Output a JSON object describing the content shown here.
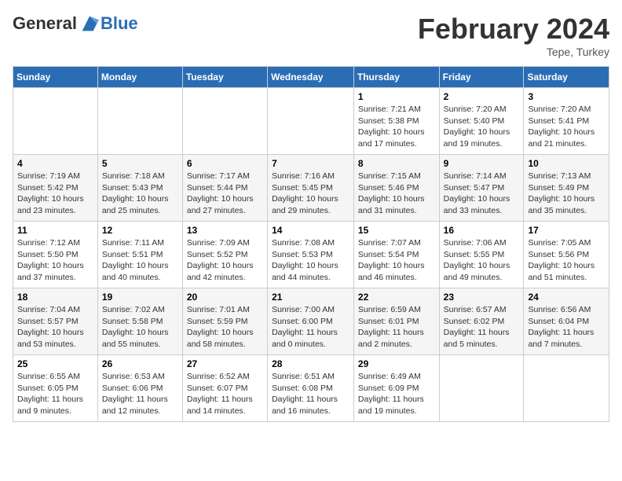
{
  "logo": {
    "general": "General",
    "blue": "Blue"
  },
  "header": {
    "title": "February 2024",
    "subtitle": "Tepe, Turkey"
  },
  "weekdays": [
    "Sunday",
    "Monday",
    "Tuesday",
    "Wednesday",
    "Thursday",
    "Friday",
    "Saturday"
  ],
  "weeks": [
    [
      {
        "day": "",
        "info": ""
      },
      {
        "day": "",
        "info": ""
      },
      {
        "day": "",
        "info": ""
      },
      {
        "day": "",
        "info": ""
      },
      {
        "day": "1",
        "info": "Sunrise: 7:21 AM\nSunset: 5:38 PM\nDaylight: 10 hours\nand 17 minutes."
      },
      {
        "day": "2",
        "info": "Sunrise: 7:20 AM\nSunset: 5:40 PM\nDaylight: 10 hours\nand 19 minutes."
      },
      {
        "day": "3",
        "info": "Sunrise: 7:20 AM\nSunset: 5:41 PM\nDaylight: 10 hours\nand 21 minutes."
      }
    ],
    [
      {
        "day": "4",
        "info": "Sunrise: 7:19 AM\nSunset: 5:42 PM\nDaylight: 10 hours\nand 23 minutes."
      },
      {
        "day": "5",
        "info": "Sunrise: 7:18 AM\nSunset: 5:43 PM\nDaylight: 10 hours\nand 25 minutes."
      },
      {
        "day": "6",
        "info": "Sunrise: 7:17 AM\nSunset: 5:44 PM\nDaylight: 10 hours\nand 27 minutes."
      },
      {
        "day": "7",
        "info": "Sunrise: 7:16 AM\nSunset: 5:45 PM\nDaylight: 10 hours\nand 29 minutes."
      },
      {
        "day": "8",
        "info": "Sunrise: 7:15 AM\nSunset: 5:46 PM\nDaylight: 10 hours\nand 31 minutes."
      },
      {
        "day": "9",
        "info": "Sunrise: 7:14 AM\nSunset: 5:47 PM\nDaylight: 10 hours\nand 33 minutes."
      },
      {
        "day": "10",
        "info": "Sunrise: 7:13 AM\nSunset: 5:49 PM\nDaylight: 10 hours\nand 35 minutes."
      }
    ],
    [
      {
        "day": "11",
        "info": "Sunrise: 7:12 AM\nSunset: 5:50 PM\nDaylight: 10 hours\nand 37 minutes."
      },
      {
        "day": "12",
        "info": "Sunrise: 7:11 AM\nSunset: 5:51 PM\nDaylight: 10 hours\nand 40 minutes."
      },
      {
        "day": "13",
        "info": "Sunrise: 7:09 AM\nSunset: 5:52 PM\nDaylight: 10 hours\nand 42 minutes."
      },
      {
        "day": "14",
        "info": "Sunrise: 7:08 AM\nSunset: 5:53 PM\nDaylight: 10 hours\nand 44 minutes."
      },
      {
        "day": "15",
        "info": "Sunrise: 7:07 AM\nSunset: 5:54 PM\nDaylight: 10 hours\nand 46 minutes."
      },
      {
        "day": "16",
        "info": "Sunrise: 7:06 AM\nSunset: 5:55 PM\nDaylight: 10 hours\nand 49 minutes."
      },
      {
        "day": "17",
        "info": "Sunrise: 7:05 AM\nSunset: 5:56 PM\nDaylight: 10 hours\nand 51 minutes."
      }
    ],
    [
      {
        "day": "18",
        "info": "Sunrise: 7:04 AM\nSunset: 5:57 PM\nDaylight: 10 hours\nand 53 minutes."
      },
      {
        "day": "19",
        "info": "Sunrise: 7:02 AM\nSunset: 5:58 PM\nDaylight: 10 hours\nand 55 minutes."
      },
      {
        "day": "20",
        "info": "Sunrise: 7:01 AM\nSunset: 5:59 PM\nDaylight: 10 hours\nand 58 minutes."
      },
      {
        "day": "21",
        "info": "Sunrise: 7:00 AM\nSunset: 6:00 PM\nDaylight: 11 hours\nand 0 minutes."
      },
      {
        "day": "22",
        "info": "Sunrise: 6:59 AM\nSunset: 6:01 PM\nDaylight: 11 hours\nand 2 minutes."
      },
      {
        "day": "23",
        "info": "Sunrise: 6:57 AM\nSunset: 6:02 PM\nDaylight: 11 hours\nand 5 minutes."
      },
      {
        "day": "24",
        "info": "Sunrise: 6:56 AM\nSunset: 6:04 PM\nDaylight: 11 hours\nand 7 minutes."
      }
    ],
    [
      {
        "day": "25",
        "info": "Sunrise: 6:55 AM\nSunset: 6:05 PM\nDaylight: 11 hours\nand 9 minutes."
      },
      {
        "day": "26",
        "info": "Sunrise: 6:53 AM\nSunset: 6:06 PM\nDaylight: 11 hours\nand 12 minutes."
      },
      {
        "day": "27",
        "info": "Sunrise: 6:52 AM\nSunset: 6:07 PM\nDaylight: 11 hours\nand 14 minutes."
      },
      {
        "day": "28",
        "info": "Sunrise: 6:51 AM\nSunset: 6:08 PM\nDaylight: 11 hours\nand 16 minutes."
      },
      {
        "day": "29",
        "info": "Sunrise: 6:49 AM\nSunset: 6:09 PM\nDaylight: 11 hours\nand 19 minutes."
      },
      {
        "day": "",
        "info": ""
      },
      {
        "day": "",
        "info": ""
      }
    ]
  ]
}
